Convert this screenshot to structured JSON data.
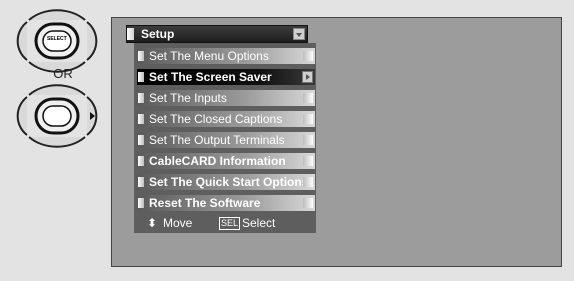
{
  "remote": {
    "select_button_label": "SELECT",
    "or_label": "OR"
  },
  "menu": {
    "title": "Setup",
    "items": [
      {
        "label": "Set The Menu Options",
        "selected": false
      },
      {
        "label": "Set The Screen Saver",
        "selected": true
      },
      {
        "label": "Set The Inputs",
        "selected": false
      },
      {
        "label": "Set The Closed Captions",
        "selected": false
      },
      {
        "label": "Set The Output Terminals",
        "selected": false
      },
      {
        "label": "CableCARD Information",
        "selected": false
      },
      {
        "label": "Set The Quick Start Options",
        "selected": false
      },
      {
        "label": "Reset The Software",
        "selected": false
      }
    ]
  },
  "status": {
    "move_label": "Move",
    "sel_icon_label": "SEL",
    "select_label": "Select"
  },
  "colors": {
    "background": "#e3e3e3",
    "panel": "#9c9c9c",
    "selected_item": "#000000",
    "menu_frame": "#5e5e5e"
  }
}
